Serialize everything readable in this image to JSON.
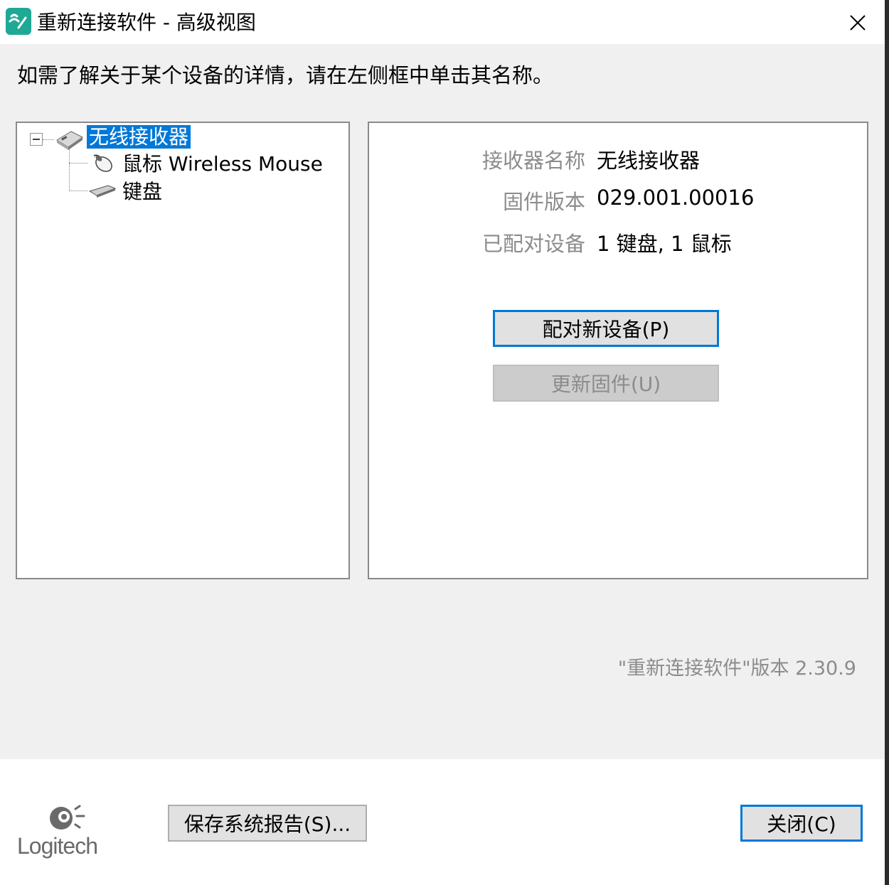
{
  "window": {
    "title": "重新连接软件 - 高级视图"
  },
  "instruction": "如需了解关于某个设备的详情，请在左侧框中单击其名称。",
  "tree": {
    "root": "无线接收器",
    "children": [
      "鼠标 Wireless Mouse",
      "键盘"
    ]
  },
  "details": {
    "receiver_name_label": "接收器名称",
    "receiver_name_value": "无线接收器",
    "firmware_label": "固件版本",
    "firmware_value": "029.001.00016",
    "paired_label": "已配对设备",
    "paired_value": "1 键盘, 1 鼠标"
  },
  "buttons": {
    "pair": "配对新设备(P)",
    "update": "更新固件(U)",
    "save_report": "保存系统报告(S)...",
    "close": "关闭(C)"
  },
  "version_text": "\"重新连接软件\"版本 2.30.9",
  "logo": {
    "text": "Logitech"
  },
  "colors": {
    "selection": "#0078d7",
    "app_icon": "#1fa895",
    "window_bg": "#f0f0f0"
  }
}
